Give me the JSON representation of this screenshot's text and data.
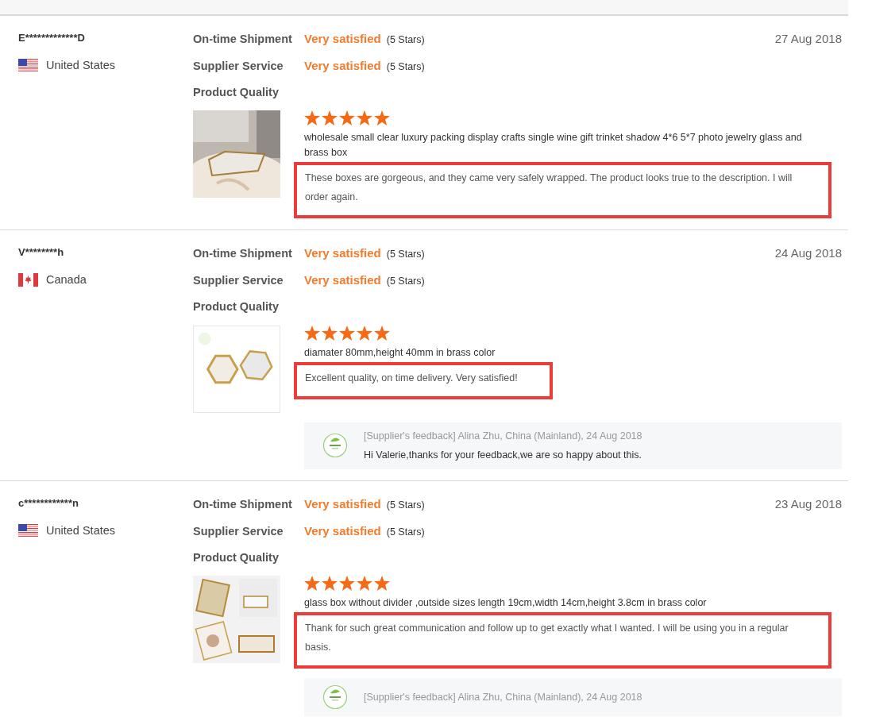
{
  "reviews": [
    {
      "buyer": "E*************D",
      "flag": {
        "kind": "us"
      },
      "country": "United States",
      "date": "27 Aug 2018",
      "ratings": [
        {
          "label": "On-time Shipment",
          "value": "Very satisfied",
          "note": "(5 Stars)"
        },
        {
          "label": "Supplier Service",
          "value": "Very satisfied",
          "note": "(5 Stars)"
        },
        {
          "label": "Product Quality"
        }
      ],
      "stars": 5,
      "product": "wholesale small clear luxury packing display crafts single wine gift trinket shadow 4*6 5*7 photo jewelry glass and brass box",
      "comment": "These boxes are gorgeous, and they came very safely wrapped. The product looks true to the description. I will order again."
    },
    {
      "buyer": "V********h",
      "flag": {
        "kind": "ca"
      },
      "country": "Canada",
      "date": "24 Aug 2018",
      "ratings": [
        {
          "label": "On-time Shipment",
          "value": "Very satisfied",
          "note": "(5 Stars)"
        },
        {
          "label": "Supplier Service",
          "value": "Very satisfied",
          "note": "(5 Stars)"
        },
        {
          "label": "Product Quality"
        }
      ],
      "stars": 5,
      "product": "diamater 80mm,height 40mm in brass color",
      "comment": "Excellent quality, on time delivery. Very satisfied!",
      "feedback": {
        "header": "[Supplier's feedback] Alina Zhu, China (Mainland), 24 Aug 2018",
        "message": "Hi Valerie,thanks for your feedback,we are so happy about this."
      }
    },
    {
      "buyer": "c************n",
      "flag": {
        "kind": "us"
      },
      "country": "United States",
      "date": "23 Aug 2018",
      "ratings": [
        {
          "label": "On-time Shipment",
          "value": "Very satisfied",
          "note": "(5 Stars)"
        },
        {
          "label": "Supplier Service",
          "value": "Very satisfied",
          "note": "(5 Stars)"
        },
        {
          "label": "Product Quality"
        }
      ],
      "stars": 5,
      "product": "glass box without divider ,outside sizes length 19cm,width 14cm,height 3.8cm in brass color",
      "comment": "Thank for such great communication and follow up to get exactly what I wanted. I will be using you in a regular basis.",
      "feedback": {
        "header": "[Supplier's feedback] Alina Zhu, China (Mainland), 24 Aug 2018"
      }
    }
  ]
}
